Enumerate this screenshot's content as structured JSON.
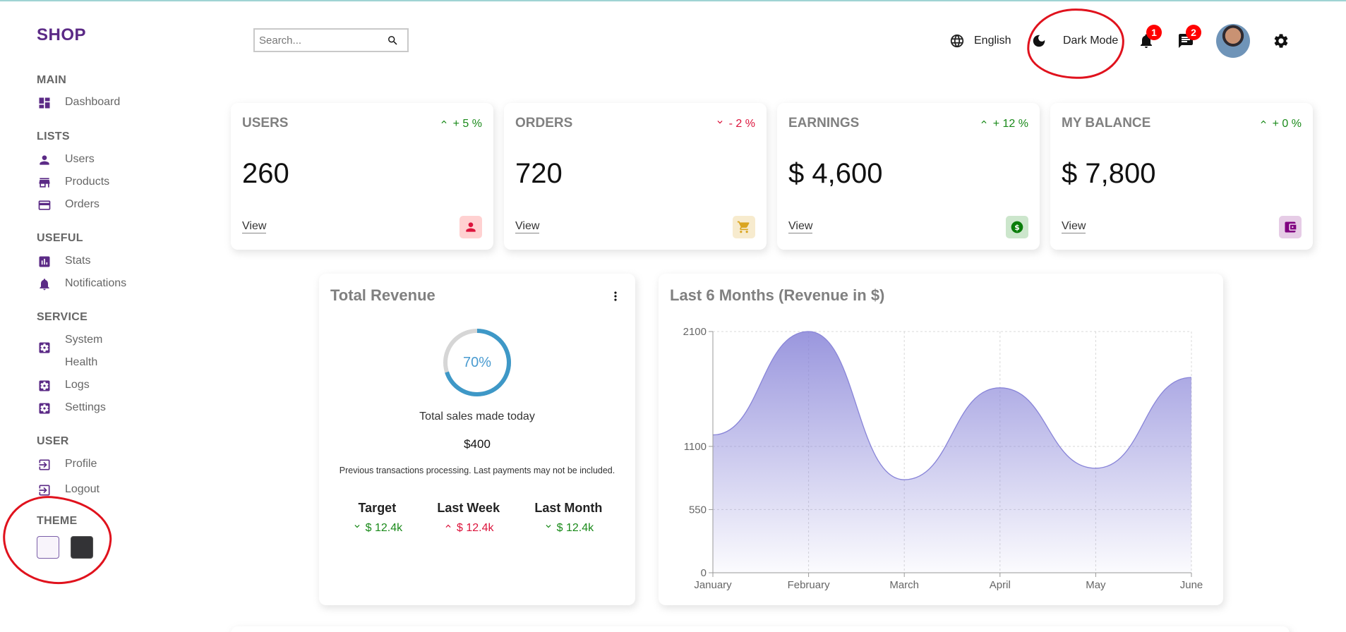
{
  "sidebar": {
    "logo": "SHOP",
    "sections": {
      "main": "MAIN",
      "lists": "LISTS",
      "useful": "USEFUL",
      "service": "SERVICE",
      "user": "USER",
      "theme": "THEME"
    },
    "items": {
      "dashboard": "Dashboard",
      "users": "Users",
      "products": "Products",
      "orders": "Orders",
      "stats": "Stats",
      "notifications": "Notifications",
      "system_health_1": "System",
      "system_health_2": "Health",
      "logs": "Logs",
      "settings": "Settings",
      "profile": "Profile",
      "logout": "Logout"
    },
    "accent_color": "#5b2a86"
  },
  "navbar": {
    "search_placeholder": "Search...",
    "language": "English",
    "dark_mode": "Dark Mode",
    "notifications_count": "1",
    "messages_count": "2"
  },
  "widgets": [
    {
      "title": "USERS",
      "pct": "+ 5 %",
      "trend": "up",
      "value": "260",
      "link": "View",
      "icon": "person-icon"
    },
    {
      "title": "ORDERS",
      "pct": "- 2 %",
      "trend": "down",
      "value": "720",
      "link": "View",
      "icon": "cart-icon"
    },
    {
      "title": "EARNINGS",
      "pct": "+ 12 %",
      "trend": "up",
      "value": "$ 4,600",
      "link": "View",
      "icon": "dollar-icon"
    },
    {
      "title": "MY BALANCE",
      "pct": "+ 0 %",
      "trend": "up",
      "value": "$ 7,800",
      "link": "View",
      "icon": "wallet-icon"
    }
  ],
  "featured": {
    "title": "Total Revenue",
    "progress_pct": 70,
    "progress_label": "70%",
    "caption": "Total sales made today",
    "amount": "$400",
    "description": "Previous transactions processing. Last payments may not be included.",
    "stats": [
      {
        "title": "Target",
        "value": "$ 12.4k",
        "trend": "down"
      },
      {
        "title": "Last Week",
        "value": "$ 12.4k",
        "trend": "up"
      },
      {
        "title": "Last Month",
        "value": "$ 12.4k",
        "trend": "down"
      }
    ]
  },
  "chart_data": {
    "type": "area",
    "title": "Last 6 Months (Revenue in $)",
    "categories": [
      "January",
      "February",
      "March",
      "April",
      "May",
      "June"
    ],
    "series": [
      {
        "values": [
          1200,
          2100,
          810,
          1610,
          910,
          1700
        ]
      }
    ],
    "yticks": [
      0,
      550,
      1100,
      2100
    ],
    "ylim": [
      0,
      2100
    ],
    "grid": true,
    "color": "#8884d8"
  }
}
